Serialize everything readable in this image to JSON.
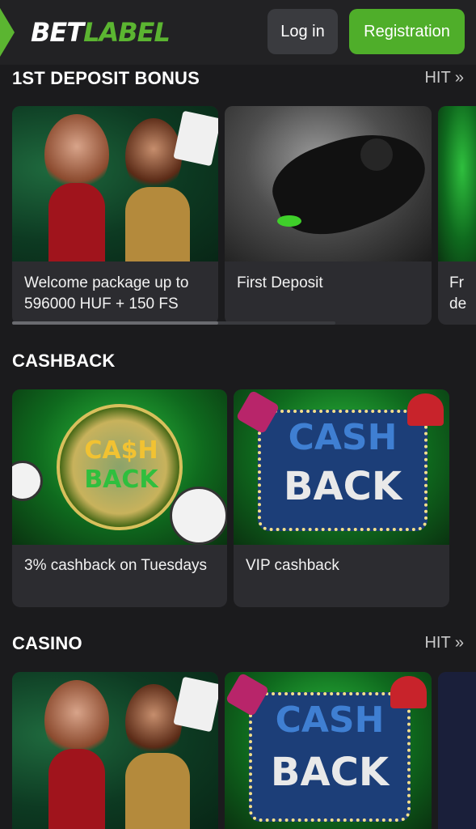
{
  "header": {
    "logo_bet": "BET",
    "logo_label": "LABEL",
    "login_label": "Log in",
    "registration_label": "Registration"
  },
  "sections": [
    {
      "title": "1ST DEPOSIT BONUS",
      "hit_label": "HIT »",
      "cards": [
        {
          "text": "Welcome package up to 596000 HUF + 150 FS",
          "art": "casino-women"
        },
        {
          "text": "First Deposit",
          "art": "football-player"
        },
        {
          "text": "Fr de",
          "art": "green-partial"
        }
      ]
    },
    {
      "title": "CASHBACK",
      "cards": [
        {
          "text": "3% cashback on Tuesdays",
          "art": "cashback-coin",
          "art_text_1": "CA$H",
          "art_text_2": "BACK"
        },
        {
          "text": "VIP cashback",
          "art": "cashback-sign",
          "art_text_1": "CASH",
          "art_text_2": "BACK"
        }
      ]
    },
    {
      "title": "CASINO",
      "hit_label": "HIT »",
      "cards": [
        {
          "art": "casino-women"
        },
        {
          "art": "cashback-sign",
          "art_text_1": "CASH",
          "art_text_2": "BACK"
        },
        {
          "art": "blue-partial"
        }
      ]
    }
  ],
  "colors": {
    "background": "#1b1b1d",
    "header": "#222224",
    "accent_green": "#4fae2a",
    "card": "#2c2c30"
  }
}
